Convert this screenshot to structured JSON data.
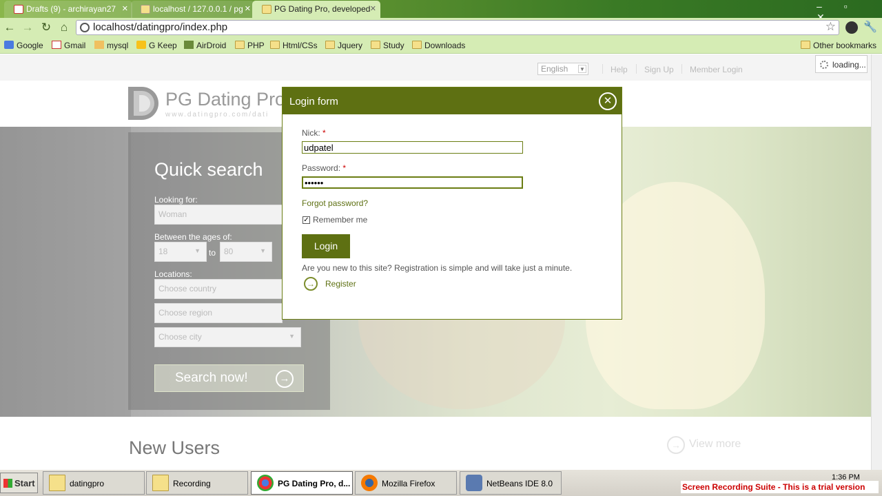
{
  "browser": {
    "tabs": [
      {
        "label": "Drafts (9) - archirayan27",
        "icon": "gmail-icon"
      },
      {
        "label": "localhost / 127.0.0.1 / pg",
        "icon": "phpmyadmin-icon"
      },
      {
        "label": "PG Dating Pro, developed",
        "icon": "folder-icon"
      }
    ],
    "window_controls": "– ▫ ✕",
    "address": "localhost/datingpro/index.php",
    "bookmarks": [
      "Google",
      "Gmail",
      "mysql",
      "G Keep",
      "AirDroid",
      "PHP",
      "Html/CSs",
      "Jquery",
      "Study",
      "Downloads"
    ],
    "other_bookmarks": "Other bookmarks",
    "loading": "loading..."
  },
  "site": {
    "language": "English",
    "toplinks": [
      "Help",
      "Sign Up",
      "Member Login"
    ],
    "logo_text": "PG Dating Pro",
    "logo_sub": "www.datingpro.com/dati",
    "quick_search": {
      "title": "Quick search",
      "looking_for_label": "Looking for:",
      "looking_for_value": "Woman",
      "ages_label": "Between the ages of:",
      "age_from": "18",
      "age_to_text": "to",
      "age_to": "80",
      "locations_label": "Locations:",
      "country_placeholder": "Choose country",
      "region_placeholder": "Choose region",
      "city_placeholder": "Choose city",
      "search_button": "Search now!"
    },
    "new_users": "New Users",
    "view_more": "View more"
  },
  "login": {
    "title": "Login form",
    "nick_label": "Nick:",
    "nick_value": "udpatel",
    "password_label": "Password:",
    "password_value": "••••••",
    "required_mark": "*",
    "forgot": "Forgot password?",
    "remember": "Remember me",
    "remember_checked": true,
    "login_button": "Login",
    "new_text": "Are you new to this site? Registration is simple and will take just a minute.",
    "register": "Register"
  },
  "taskbar": {
    "start": "Start",
    "items": [
      "datingpro",
      "Recording",
      "PG Dating Pro, d...",
      "Mozilla Firefox",
      "NetBeans IDE 8.0"
    ],
    "clock": "1:36 PM",
    "trial_banner": "Screen Recording Suite - This is a trial version"
  },
  "colors": {
    "chrome_theme": "#d5ecb4",
    "modal_accent": "#5e7012"
  }
}
